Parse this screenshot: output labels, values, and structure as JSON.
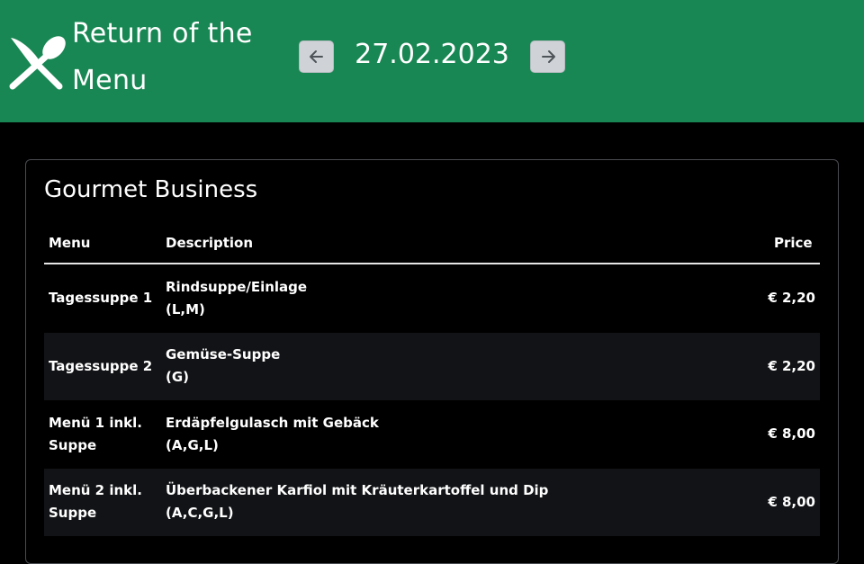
{
  "header": {
    "brand": "Return of the Menu",
    "date": "27.02.2023",
    "icons": {
      "logo": "fork-spoon-cross-icon",
      "prev": "arrow-left-icon",
      "next": "arrow-right-icon"
    },
    "colors": {
      "background": "#198754",
      "nav_button": "#cfd3d7"
    }
  },
  "card": {
    "title": "Gourmet Business",
    "columns": {
      "menu": "Menu",
      "description": "Description",
      "price": "Price"
    },
    "rows": [
      {
        "menu": "Tagessuppe 1",
        "description": "Rindsuppe/Einlage",
        "allergens": "(L,M)",
        "price": "€ 2,20"
      },
      {
        "menu": "Tagessuppe 2",
        "description": "Gemüse-Suppe",
        "allergens": "(G)",
        "price": "€ 2,20"
      },
      {
        "menu": "Menü 1 inkl. Suppe",
        "description": "Erdäpfelgulasch mit Gebäck",
        "allergens": "(A,G,L)",
        "price": "€ 8,00"
      },
      {
        "menu": "Menü 2 inkl. Suppe",
        "description": "Überbackener Karfiol mit Kräuterkartoffel und Dip",
        "allergens": "(A,C,G,L)",
        "price": "€ 8,00"
      }
    ]
  }
}
